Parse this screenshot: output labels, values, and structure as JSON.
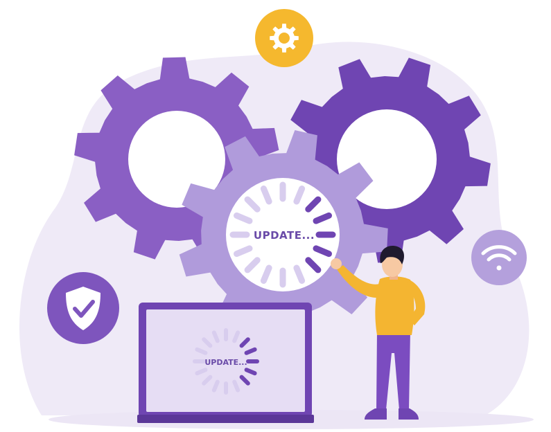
{
  "gear_label": "UPDATE...",
  "laptop_label": "UPDATE...",
  "icons": {
    "top_badge": "gear-icon",
    "left_badge": "shield-check-icon",
    "right_badge": "wifi-icon"
  },
  "colors": {
    "dark_purple": "#6f45b2",
    "mid_purple": "#8d63c8",
    "light_purple": "#b09bdb",
    "blob_lavender": "#efeaf7",
    "yellow": "#f5b82e",
    "shirt_yellow": "#f4b531",
    "text_purple": "#6a4ba8"
  }
}
